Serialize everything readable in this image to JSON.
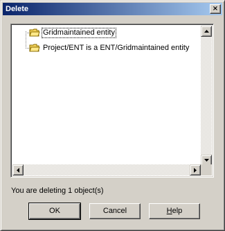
{
  "window": {
    "title": "Delete",
    "close_label": "×"
  },
  "tree": {
    "items": [
      {
        "label": "Gridmaintained entity",
        "icon": "folder-icon",
        "selected": true
      },
      {
        "label": "Project/ENT is a ENT/Gridmaintained entity",
        "icon": "folder-icon",
        "selected": false
      }
    ]
  },
  "status": {
    "text": "You are deleting 1 object(s)"
  },
  "buttons": {
    "ok": "OK",
    "cancel": "Cancel",
    "help_prefix": "",
    "help_mnemonic": "H",
    "help_rest": "elp"
  },
  "colors": {
    "titlebar_start": "#0a246a",
    "titlebar_end": "#a6caf0",
    "face": "#d4d0c8",
    "folder": "#f4d35e"
  }
}
